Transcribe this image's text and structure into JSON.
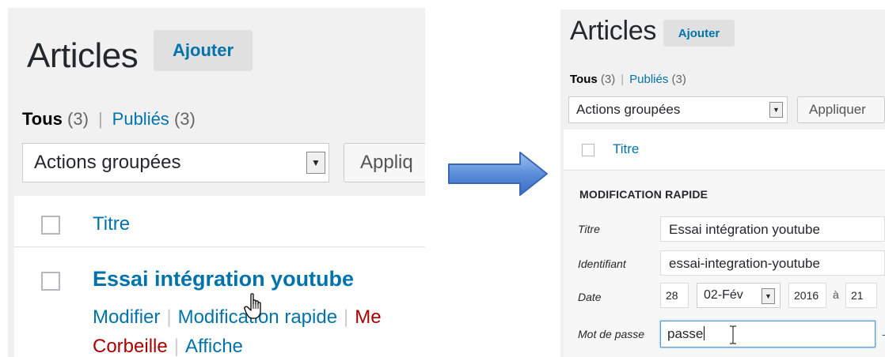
{
  "left": {
    "page_title": "Articles",
    "add_button": "Ajouter",
    "filters": {
      "all_label": "Tous",
      "all_count": "(3)",
      "separator": "|",
      "published_label": "Publiés",
      "published_count": "(3)"
    },
    "bulk_select": "Actions groupées",
    "apply_button": "Appliq",
    "column_title": "Titre",
    "post_title": "Essai intégration youtube",
    "row_actions": {
      "edit": "Modifier",
      "quick_edit": "Modification rapide",
      "more": "Me",
      "trash": "Corbeille",
      "view": "Affiche"
    }
  },
  "right": {
    "page_title": "Articles",
    "add_button": "Ajouter",
    "filters": {
      "all_label": "Tous",
      "all_count": "(3)",
      "separator": "|",
      "published_label": "Publiés",
      "published_count": "(3)"
    },
    "bulk_select": "Actions groupées",
    "apply_button": "Appliquer",
    "column_title": "Titre",
    "quick_edit": {
      "heading": "MODIFICATION RAPIDE",
      "title_label": "Titre",
      "title_value": "Essai intégration youtube",
      "slug_label": "Identifiant",
      "slug_value": "essai-integration-youtube",
      "date_label": "Date",
      "day": "28",
      "month": "02-Fév",
      "year": "2016",
      "at": "à",
      "hour": "21",
      "password_label": "Mot de passe",
      "password_value": "passe",
      "dash": "-"
    }
  },
  "colors": {
    "link": "#0073aa",
    "destructive": "#a00",
    "arrow": "#4a7fd0"
  },
  "icons": {
    "dropdown": "▼",
    "cursor": "hand-pointer-icon",
    "text_cursor": "i-beam-icon",
    "arrow": "right-arrow-icon"
  }
}
